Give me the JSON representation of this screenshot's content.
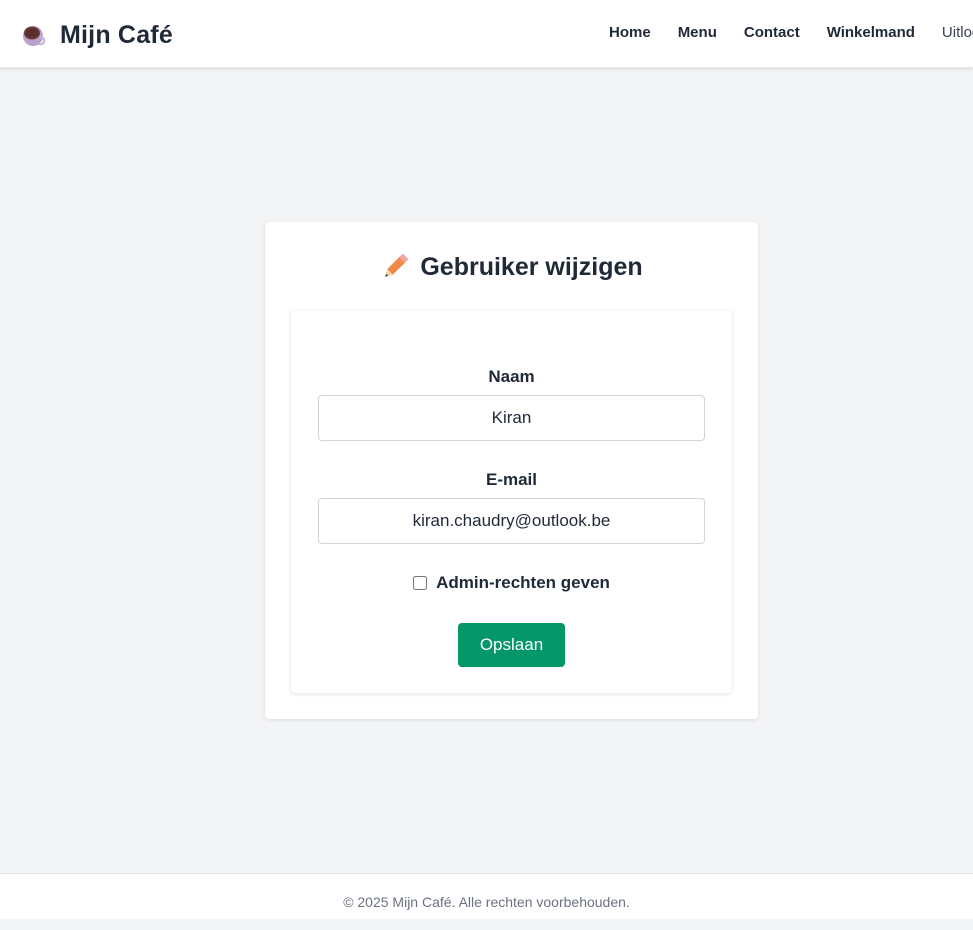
{
  "header": {
    "brand_icon": "coffee-cup-icon",
    "brand_title": "Mijn Café",
    "nav": {
      "home": "Home",
      "menu": "Menu",
      "contact": "Contact",
      "cart": "Winkelmand",
      "logout": "Uitloggen"
    }
  },
  "form": {
    "title_icon": "pencil-icon",
    "title": "Gebruiker wijzigen",
    "name_label": "Naam",
    "name_value": "Kiran",
    "email_label": "E-mail",
    "email_value": "kiran.chaudry@outlook.be",
    "admin_label": "Admin-rechten geven",
    "admin_checked": false,
    "save_label": "Opslaan"
  },
  "footer": {
    "text": "© 2025 Mijn Café. Alle rechten voorbehouden."
  },
  "colors": {
    "accent": "#059669",
    "background": "#f3f4f6",
    "text": "#1f2937"
  }
}
